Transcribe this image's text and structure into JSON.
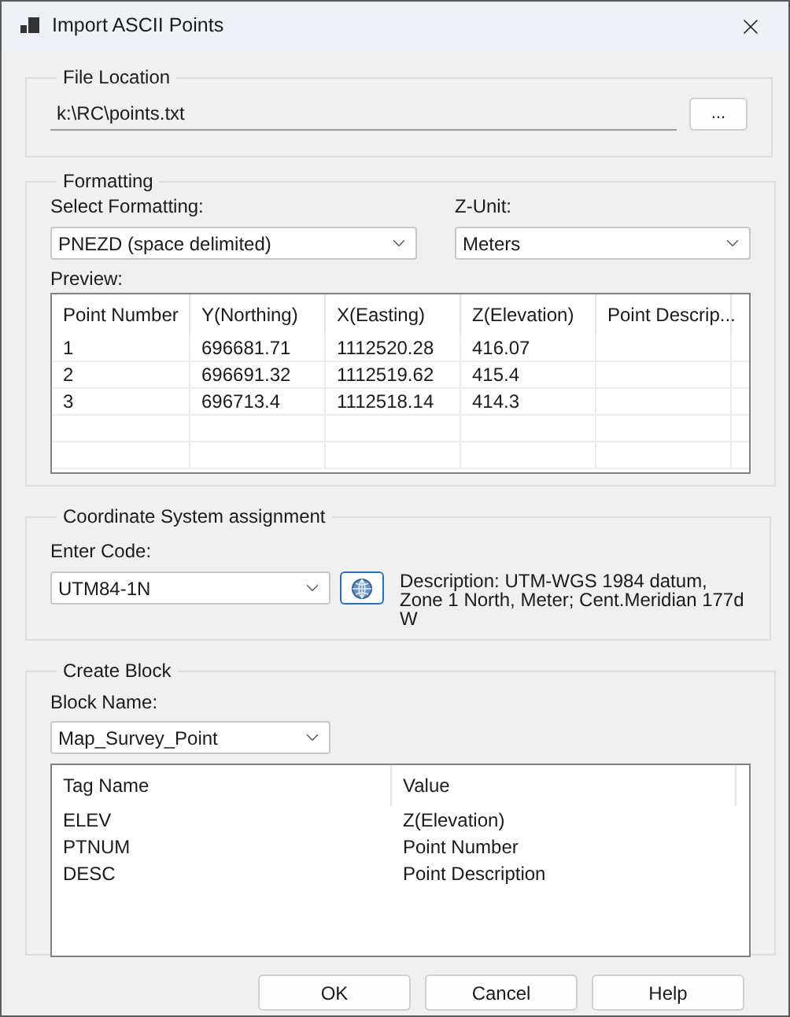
{
  "window": {
    "title": "Import ASCII Points"
  },
  "file_location": {
    "legend": "File Location",
    "path": "k:\\RC\\points.txt",
    "browse": "..."
  },
  "formatting": {
    "legend": "Formatting",
    "format_label": "Select Formatting:",
    "format_value": "PNEZD (space delimited)",
    "zunit_label": "Z-Unit:",
    "zunit_value": "Meters",
    "preview_label": "Preview:",
    "columns": [
      "Point Number",
      "Y(Northing)",
      "X(Easting)",
      "Z(Elevation)",
      "Point Descrip..."
    ],
    "rows": [
      [
        "1",
        "696681.71",
        "1112520.28",
        "416.07",
        ""
      ],
      [
        "2",
        "696691.32",
        "1112519.62",
        "415.4",
        ""
      ],
      [
        "3",
        "696713.4",
        "1112518.14",
        "414.3",
        ""
      ]
    ]
  },
  "coordinate_system": {
    "legend": "Coordinate System assignment",
    "code_label": "Enter Code:",
    "code_value": "UTM84-1N",
    "description": "Description: UTM-WGS 1984 datum, Zone 1 North, Meter; Cent.Meridian 177d W"
  },
  "create_block": {
    "legend": "Create Block",
    "block_label": "Block Name:",
    "block_value": "Map_Survey_Point",
    "columns": [
      "Tag Name",
      "Value"
    ],
    "rows": [
      [
        "ELEV",
        "Z(Elevation)"
      ],
      [
        "PTNUM",
        "Point Number"
      ],
      [
        "DESC",
        "Point Description"
      ]
    ]
  },
  "buttons": [
    "OK",
    "Cancel",
    "Help"
  ]
}
